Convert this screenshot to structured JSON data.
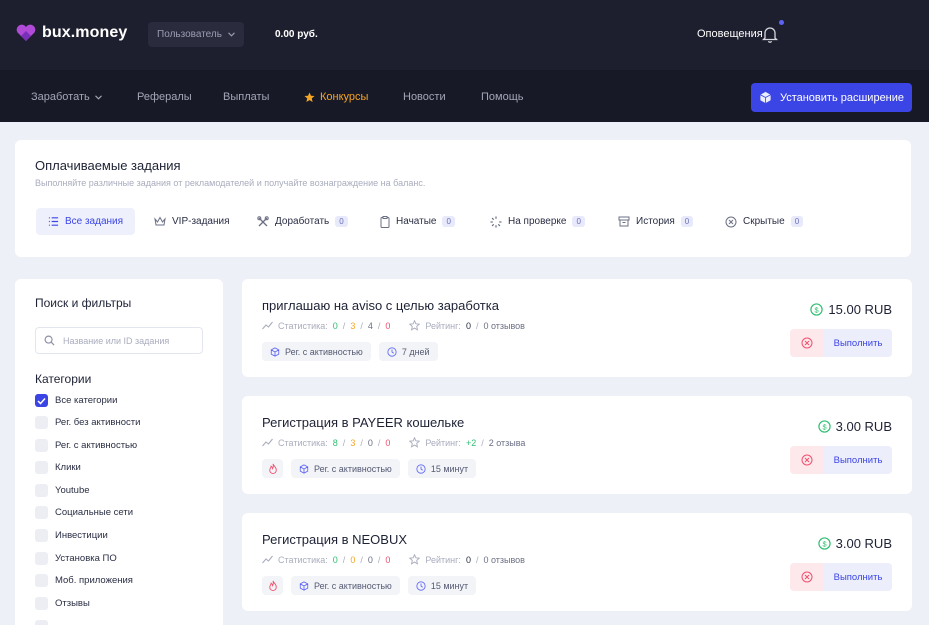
{
  "header": {
    "logo_text": "bux.money",
    "user_dropdown": "Пользователь",
    "balance": "0.00 руб.",
    "notifications": "Оповещения"
  },
  "nav": {
    "items": [
      {
        "label": "Заработать",
        "has_dropdown": true
      },
      {
        "label": "Рефералы"
      },
      {
        "label": "Выплаты"
      },
      {
        "label": "Конкурсы",
        "active": true
      },
      {
        "label": "Новости"
      },
      {
        "label": "Помощь"
      }
    ],
    "install_button": "Установить расширение"
  },
  "colors": {
    "accent": "#3b45e6",
    "active_nav": "#f5a524",
    "header_bg": "#1e1f2e",
    "green": "#2fbf71",
    "red": "#f0506e"
  },
  "tasks_header": {
    "title": "Оплачиваемые задания",
    "subtitle": "Выполняйте различные задания от рекламодателей и получайте вознаграждение на баланс.",
    "tabs": [
      {
        "label": "Все задания",
        "icon": "list-icon",
        "active": true
      },
      {
        "label": "VIP-задания",
        "icon": "crown-icon"
      },
      {
        "label": "Доработать",
        "icon": "tools-icon",
        "count": "0"
      },
      {
        "label": "Начатые",
        "icon": "clipboard-icon",
        "count": "0"
      },
      {
        "label": "На проверке",
        "icon": "spinner-icon",
        "count": "0"
      },
      {
        "label": "История",
        "icon": "archive-icon",
        "count": "0"
      },
      {
        "label": "Скрытые",
        "icon": "x-circle-icon",
        "count": "0"
      }
    ]
  },
  "sidebar": {
    "title": "Поиск и фильтры",
    "search_placeholder": "Название или ID задания",
    "categories_title": "Категории",
    "categories": [
      {
        "label": "Все категории",
        "checked": true
      },
      {
        "label": "Рег. без активности"
      },
      {
        "label": "Рег. с активностью"
      },
      {
        "label": "Клики"
      },
      {
        "label": "Youtube"
      },
      {
        "label": "Социальные сети"
      },
      {
        "label": "Инвестиции"
      },
      {
        "label": "Установка ПО"
      },
      {
        "label": "Моб. приложения"
      },
      {
        "label": "Отзывы"
      }
    ]
  },
  "tasks": [
    {
      "title": "приглашаю на aviso с целью заработка",
      "stats_label": "Статистика:",
      "stats": [
        "0",
        "3",
        "4",
        "0"
      ],
      "rating_label": "Рейтинг:",
      "rating": "0",
      "reviews": "0 отзывов",
      "fire": false,
      "category_tag": "Рег. с активностью",
      "time_tag": "7 дней",
      "price": "15.00 RUB",
      "action": "Выполнить"
    },
    {
      "title": "Регистрация в PAYEER кошельке",
      "stats_label": "Статистика:",
      "stats": [
        "8",
        "3",
        "0",
        "0"
      ],
      "rating_label": "Рейтинг:",
      "rating": "+2",
      "reviews": "2 отзыва",
      "fire": true,
      "category_tag": "Рег. с активностью",
      "time_tag": "15 минут",
      "price": "3.00 RUB",
      "action": "Выполнить"
    },
    {
      "title": "Регистрация в NEOBUX",
      "stats_label": "Статистика:",
      "stats": [
        "0",
        "0",
        "0",
        "0"
      ],
      "rating_label": "Рейтинг:",
      "rating": "0",
      "reviews": "0 отзывов",
      "fire": true,
      "category_tag": "Рег. с активностью",
      "time_tag": "15 минут",
      "price": "3.00 RUB",
      "action": "Выполнить"
    }
  ]
}
